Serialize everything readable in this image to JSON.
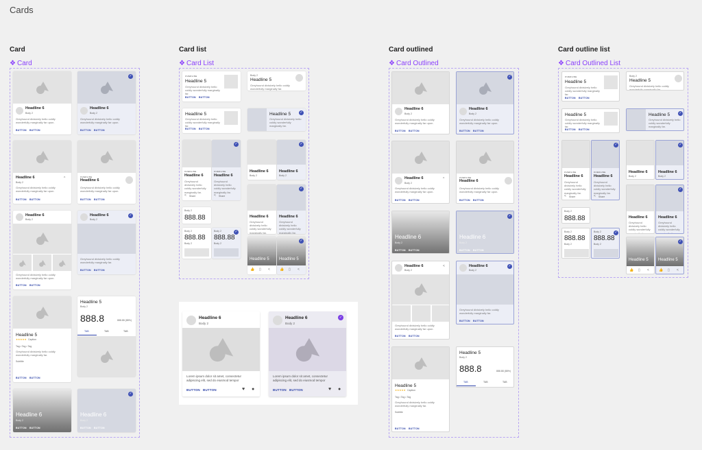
{
  "page": {
    "title": "Cards"
  },
  "sections": [
    {
      "heading": "Card",
      "component": "Card"
    },
    {
      "heading": "Card list",
      "component": "Card List"
    },
    {
      "heading": "Card outlined",
      "component": "Card Outlined"
    },
    {
      "heading": "Card outline list",
      "component": "Card Outlined List"
    }
  ],
  "text": {
    "headline5": "Headline 5",
    "headline6": "Headline 6",
    "body2": "Body 2",
    "overline": "OVERLINE",
    "greyhound": "Greyhound divisively hello coldly wonderfully marginally far.",
    "greyhound2": "Greyhound divisively hello coldly wonderfully marginally far upon.",
    "button": "BUTTON",
    "value": "888.8",
    "value_short": "888.88",
    "value_small": "888.88 (88%)",
    "tab": "TAB",
    "chips": "Tag • Tag • Tag",
    "subtitle": "Subtitle",
    "share": "Share",
    "rating": "Caption",
    "stars": "★★★★★"
  },
  "example": {
    "left": {
      "headline": "Headline 6",
      "subhead": "Body 2",
      "body": "Lorem ipsum dolor sit amet, consectetur adipiscing elit, sed do eiusmod tempor",
      "button1": "BUTTON",
      "button2": "BUTTON"
    },
    "right": {
      "headline": "Headline 6",
      "subhead": "Body 2",
      "body": "Lorem ipsum dolor sit amet, consectetur adipiscing elit, sed do eiusmod tempor",
      "button1": "BUTTON",
      "button2": "BUTTON"
    }
  },
  "colors": {
    "accent": "#8a3ffc",
    "primary": "#2d43a8",
    "selected": "#3f51b5"
  }
}
